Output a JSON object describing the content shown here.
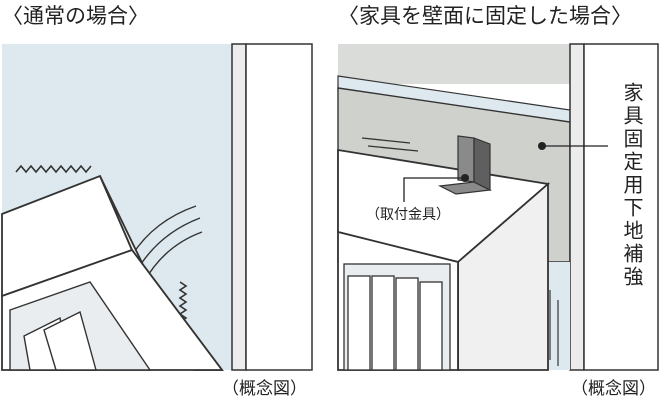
{
  "left_panel": {
    "title": "〈通常の場合〉",
    "note": "（概念図）"
  },
  "right_panel": {
    "title": "〈家具を壁面に固定した場合〉",
    "callout_bracket": "（取付金具）",
    "callout_reinforcement": "家具固定用下地補強",
    "note": "（概念図）"
  },
  "colors": {
    "stroke": "#333333",
    "wall_blue": "#dde9ef",
    "wall_gray": "#d9dcd8",
    "reinforcement_gray": "#cfd1cd",
    "bracket_gray": "#8a8a8a"
  }
}
